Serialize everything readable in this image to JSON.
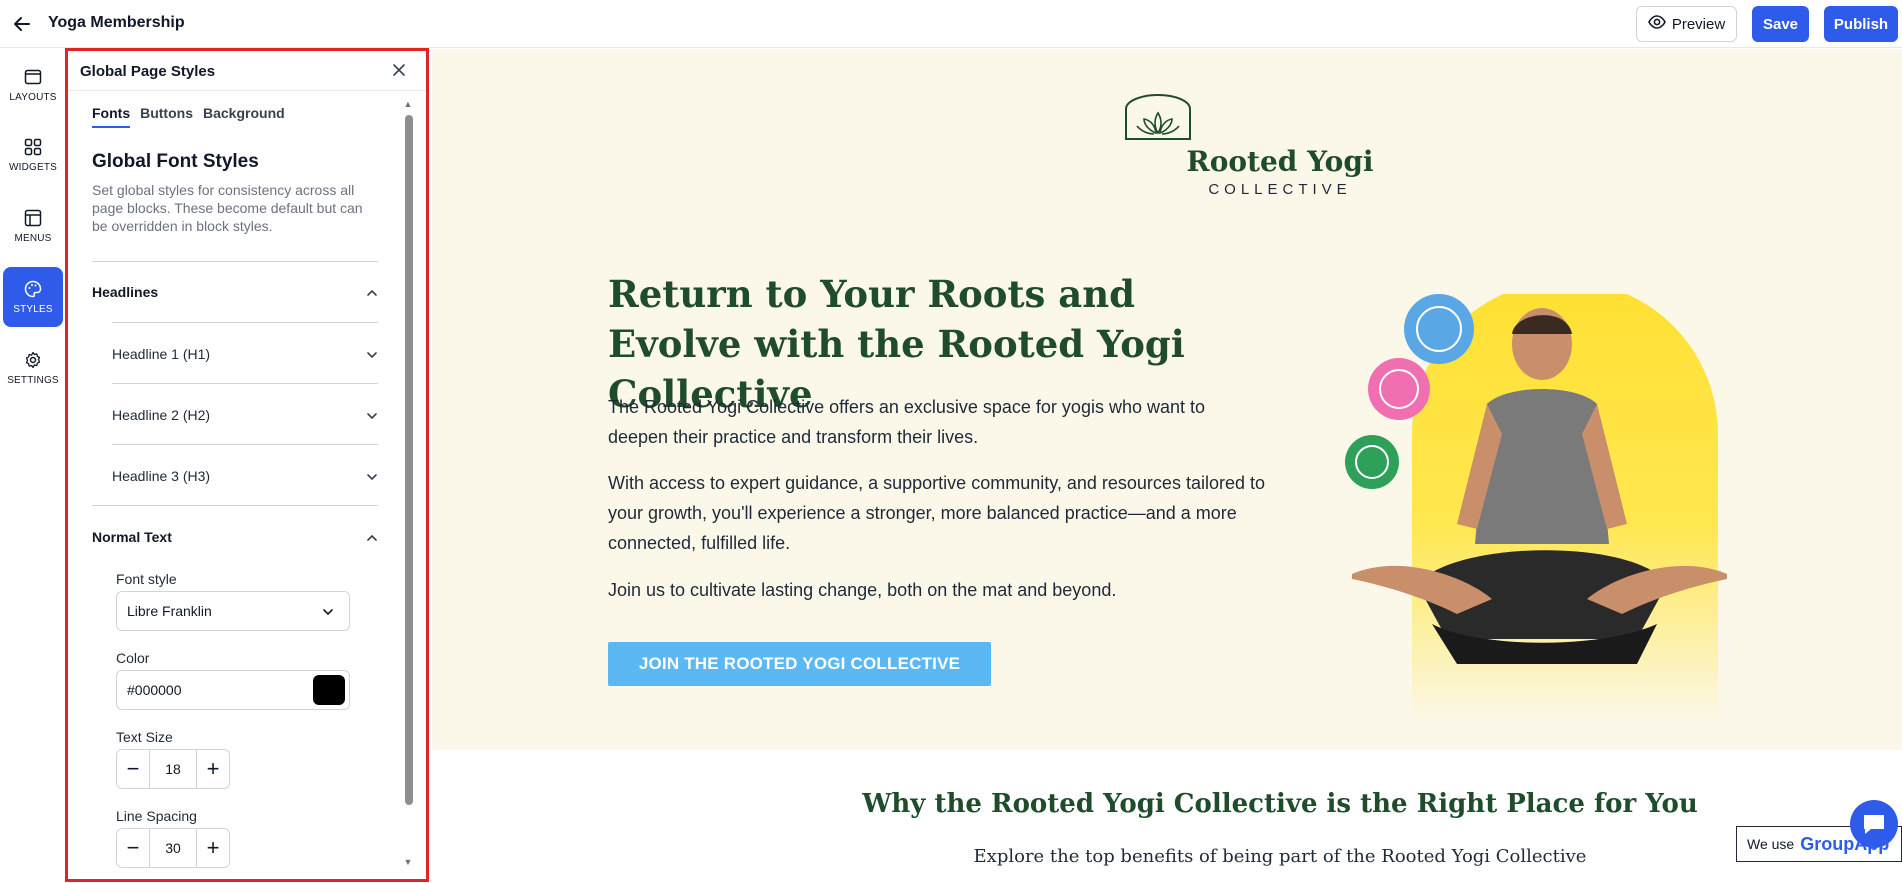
{
  "header": {
    "title": "Yoga Membership",
    "preview_label": "Preview",
    "save_label": "Save",
    "publish_label": "Publish"
  },
  "rail": {
    "items": [
      {
        "label": "LAYOUTS",
        "icon": "layout-icon"
      },
      {
        "label": "WIDGETS",
        "icon": "widgets-grid-icon"
      },
      {
        "label": "MENUS",
        "icon": "menus-icon"
      },
      {
        "label": "STYLES",
        "icon": "palette-icon",
        "active": true
      },
      {
        "label": "SETTINGS",
        "icon": "gear-icon"
      }
    ]
  },
  "panel": {
    "title": "Global Page Styles",
    "tabs": [
      "Fonts",
      "Buttons",
      "Background"
    ],
    "active_tab": "Fonts",
    "section_title": "Global Font Styles",
    "description": "Set global styles for consistency across all page blocks. These become default but can be overridden in block styles.",
    "headlines_label": "Headlines",
    "headline_items": [
      "Headline 1 (H1)",
      "Headline 2 (H2)",
      "Headline 3 (H3)"
    ],
    "normal_text_label": "Normal Text",
    "font_style_label": "Font style",
    "font_style_value": "Libre Franklin",
    "color_label": "Color",
    "color_value": "#000000",
    "text_size_label": "Text Size",
    "text_size_value": "18",
    "line_spacing_label": "Line Spacing",
    "line_spacing_value": "30"
  },
  "canvas": {
    "logo_name": "Rooted Yogi",
    "logo_sub": "COLLECTIVE",
    "hero_title": "Return to Your Roots and Evolve with the Rooted Yogi Collective",
    "hero_p1": "The Rooted Yogi Collective offers an exclusive space for yogis who want to deepen their practice and transform their lives.",
    "hero_p2": "With access to expert guidance, a supportive community, and resources tailored to your growth, you'll experience a stronger, more balanced practice—and a more connected, fulfilled life.",
    "hero_p3": "Join us to cultivate lasting change, both on the mat and beyond.",
    "cta_label": "JOIN THE ROOTED YOGI COLLECTIVE",
    "why_title": "Why the Rooted Yogi Collective is the Right Place for You",
    "why_sub": "Explore the top benefits of being part of the Rooted Yogi Collective"
  },
  "footer": {
    "cookie_prefix": "We use",
    "cookie_brand": "GroupApp"
  },
  "colors": {
    "accent": "#2f5bea",
    "brand_green": "#1f4d2b",
    "hero_bg": "#fbf8ea",
    "cta": "#5bb8f2",
    "panel_highlight": "#e02424"
  }
}
